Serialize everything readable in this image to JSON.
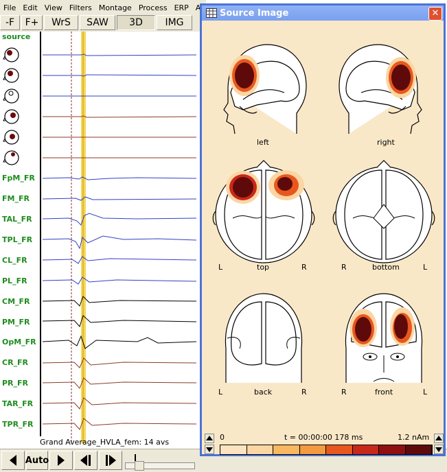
{
  "menu": [
    "File",
    "Edit",
    "View",
    "Filters",
    "Montage",
    "Process",
    "ERP",
    "Arti"
  ],
  "toolbar": {
    "buttons": [
      "-F",
      "F+",
      "WrS",
      "SAW",
      "3D",
      "IMG"
    ]
  },
  "channels": {
    "source_label": "source",
    "names": [
      "FpM_FR",
      "FM_FR",
      "TAL_FR",
      "TPL_FR",
      "CL_FR",
      "PL_FR",
      "CM_FR",
      "PM_FR",
      "OpM_FR",
      "CR_FR",
      "PR_FR",
      "TAR_FR",
      "TPR_FR"
    ]
  },
  "caption": "Grand Average_HVLA_fem: 14 avs",
  "bottom": {
    "auto_label": "Auto"
  },
  "window": {
    "title": "Source Image",
    "close_glyph": "✕",
    "views": {
      "left": "left",
      "right": "right",
      "top": "top",
      "bottom": "bottom",
      "back": "back",
      "front": "front"
    },
    "orient": {
      "L": "L",
      "R": "R"
    },
    "scale_min": "0",
    "time": "t = 00:00:00  178 ms",
    "scale_max": "1.2 nAm",
    "colorscale": [
      "#fde3bf",
      "#fbd6a3",
      "#f8b860",
      "#f49a40",
      "#e8581e",
      "#c8281a",
      "#901010",
      "#5e0a0a"
    ]
  },
  "colors": {
    "label_green": "#1e8c1e",
    "trace_blue": "#3040c8",
    "trace_brown": "#8b3a2a",
    "highlight": "#f5d85a"
  }
}
